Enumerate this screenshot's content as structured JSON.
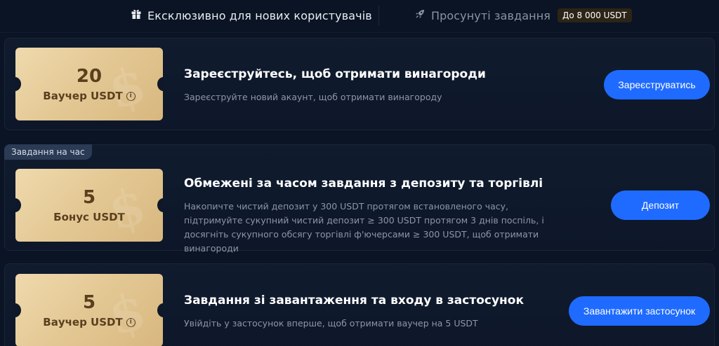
{
  "tabs": {
    "exclusive": {
      "label": "Ексклюзивно для нових користувачів",
      "icon": "gift-icon"
    },
    "advanced": {
      "label": "Просунуті завдання",
      "icon": "rocket-icon",
      "badge": "До 8 000 USDT"
    }
  },
  "tasks": [
    {
      "voucher_amount": "20",
      "voucher_unit": "Ваучер USDT",
      "has_info": true,
      "title": "Зареєструйтесь, щоб отримати винагороди",
      "description": "Зареєструйте новий акаунт, щоб отримати винагороду",
      "button": "Зареєструватись"
    },
    {
      "tag": "Завдання на час",
      "voucher_amount": "5",
      "voucher_unit": "Бонус USDT",
      "has_info": false,
      "title": "Обмежені за часом завдання з депозиту та торгівлі",
      "description": "Накопичте чистий депозит у 300 USDT протягом встановленого часу, підтримуйте сукупний чистий депозит ≥ 300 USDT протягом 3 днів поспіль, і досягніть сукупного обсягу торгівлі ф'ючерсами ≥ 300 USDT, щоб отримати винагороди",
      "button": "Депозит"
    },
    {
      "voucher_amount": "5",
      "voucher_unit": "Ваучер USDT",
      "has_info": true,
      "title": "Завдання зі завантаження та входу в застосунок",
      "description": "Увійдіть у застосунок вперше, щоб отримати ваучер на 5 USDT",
      "button": "Завантажити застосунок"
    }
  ],
  "colors": {
    "background": "#0a1424",
    "accent_button": "#1f6bff",
    "voucher_gold": "#e4c995",
    "voucher_text": "#5a3f1f"
  }
}
